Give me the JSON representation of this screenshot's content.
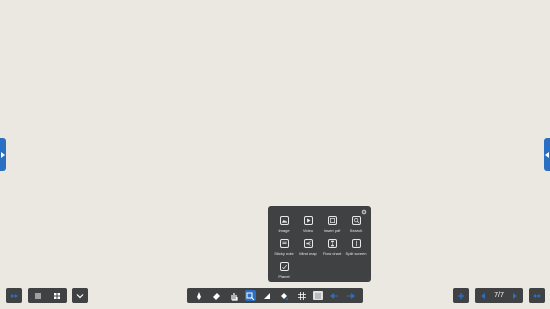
{
  "insert_menu": {
    "items": [
      {
        "label": "Image",
        "icon": "image-icon"
      },
      {
        "label": "Video",
        "icon": "video-icon"
      },
      {
        "label": "Insert pdf",
        "icon": "pdf-icon"
      },
      {
        "label": "Search",
        "icon": "search-icon"
      },
      {
        "label": "Sticky note",
        "icon": "sticky-note-icon"
      },
      {
        "label": "Mind map",
        "icon": "mind-map-icon"
      },
      {
        "label": "Flow chart",
        "icon": "flow-chart-icon"
      },
      {
        "label": "Split screen",
        "icon": "split-screen-icon"
      },
      {
        "label": "Planet",
        "icon": "planet-icon"
      }
    ]
  },
  "pager": {
    "current": 7,
    "total": 7,
    "label": "7/7"
  },
  "colors": {
    "background": "#ebe8e1",
    "toolbar": "#3f4142",
    "accent": "#2a6fc1"
  }
}
